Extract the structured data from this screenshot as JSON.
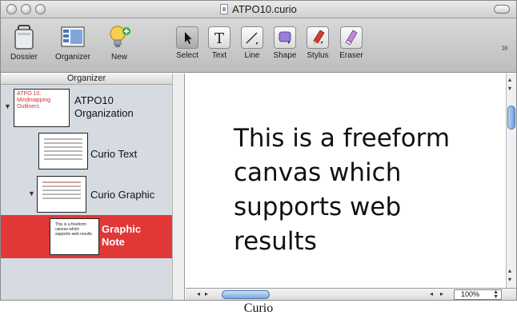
{
  "window": {
    "title": "ATPO10.curio"
  },
  "toolbar": {
    "left_buttons": [
      {
        "label": "Dossier",
        "icon": "briefcase-icon"
      },
      {
        "label": "Organizer",
        "icon": "organizer-icon"
      },
      {
        "label": "New",
        "icon": "lightbulb-icon"
      }
    ],
    "tool_buttons": [
      {
        "label": "Select",
        "icon": "arrow-icon"
      },
      {
        "label": "Text",
        "icon": "text-icon"
      },
      {
        "label": "Line",
        "icon": "line-icon"
      },
      {
        "label": "Shape",
        "icon": "shape-icon"
      },
      {
        "label": "Stylus",
        "icon": "stylus-icon"
      },
      {
        "label": "Eraser",
        "icon": "eraser-icon"
      }
    ],
    "overflow": "»"
  },
  "sidebar": {
    "header": "Organizer",
    "nodes": [
      {
        "label_line1": "ATPO10",
        "label_line2": "Organization",
        "thumb_text": "ATPO 10: Mindmapping Outliners"
      },
      {
        "label_line1": "Curio Text",
        "label_line2": ""
      },
      {
        "label_line1": "Curio Graphic",
        "label_line2": ""
      },
      {
        "label_line1": "Graphic",
        "label_line2": "Note",
        "thumb_text": "This is a freeform canvas which supports web results",
        "selected": true
      }
    ]
  },
  "canvas": {
    "lines": [
      "This is a freeform",
      "canvas which",
      "supports web",
      "results"
    ]
  },
  "statusbar": {
    "zoom": "100%"
  },
  "caption": "Curio",
  "colors": {
    "selection": "#e13736",
    "sidebar_bg": "#d6dbe2",
    "scroll_knob": "#6f9cd6"
  }
}
